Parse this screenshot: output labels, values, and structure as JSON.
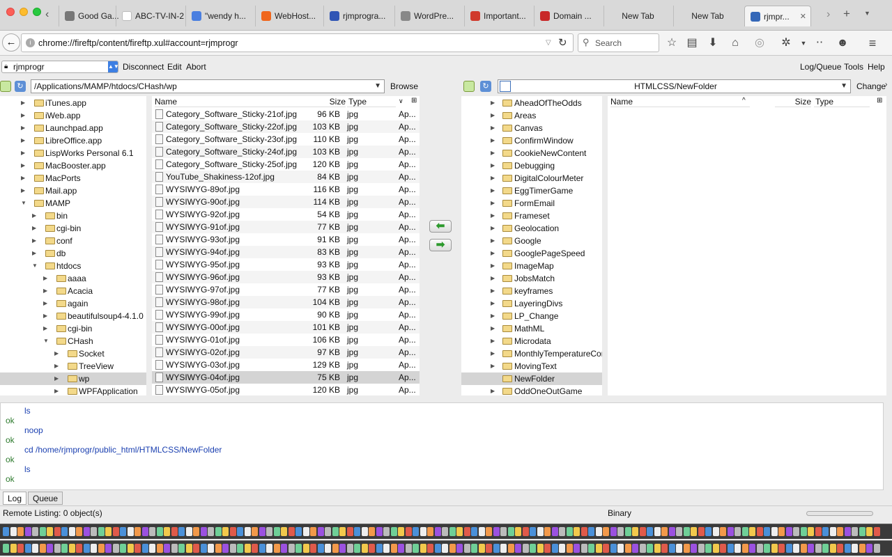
{
  "window": {
    "tabs": [
      {
        "label": "Good Ga...",
        "icon": "page-icon",
        "color": "#777777"
      },
      {
        "label": "ABC-TV-IN-2...",
        "icon": "blank-icon",
        "color": "#ffffff"
      },
      {
        "label": "\"wendy h...",
        "icon": "google-icon",
        "color": "#4a7fe0"
      },
      {
        "label": "WebHost...",
        "icon": "cpanel-icon",
        "color": "#f0661c"
      },
      {
        "label": "rjmprogra...",
        "icon": "amazon-icon",
        "color": "#2f55b5"
      },
      {
        "label": "WordPre...",
        "icon": "wordpress-icon",
        "color": "#888888"
      },
      {
        "label": "Important...",
        "icon": "gmail-icon",
        "color": "#d03a2c"
      },
      {
        "label": "Domain ...",
        "icon": "zoho-icon",
        "color": "#c82828"
      },
      {
        "label": "New Tab",
        "icon": "",
        "color": ""
      },
      {
        "label": "New Tab",
        "icon": "",
        "color": ""
      },
      {
        "label": "rjmpr...",
        "icon": "fireftp-icon",
        "color": "#3568b8"
      }
    ]
  },
  "nav": {
    "url": "chrome://fireftp/content/fireftp.xul#account=rjmprogr",
    "search_placeholder": "Search"
  },
  "ftp": {
    "account": "rjmprogr",
    "menu": {
      "disconnect": "Disconnect",
      "edit": "Edit",
      "abort": "Abort",
      "logqueue": "Log/Queue",
      "tools": "Tools",
      "help": "Help"
    },
    "local_path": "/Applications/MAMP/htdocs/CHash/wp",
    "browse": "Browse",
    "remote_path": "HTMLCSS/NewFolder",
    "change": "Change",
    "local_tree": [
      {
        "name": "iTunes.app",
        "level": 1,
        "state": "closed"
      },
      {
        "name": "iWeb.app",
        "level": 1,
        "state": "closed"
      },
      {
        "name": "Launchpad.app",
        "level": 1,
        "state": "closed"
      },
      {
        "name": "LibreOffice.app",
        "level": 1,
        "state": "closed"
      },
      {
        "name": "LispWorks Personal 6.1",
        "level": 1,
        "state": "closed"
      },
      {
        "name": "MacBooster.app",
        "level": 1,
        "state": "closed"
      },
      {
        "name": "MacPorts",
        "level": 1,
        "state": "closed"
      },
      {
        "name": "Mail.app",
        "level": 1,
        "state": "closed"
      },
      {
        "name": "MAMP",
        "level": 1,
        "state": "open"
      },
      {
        "name": "bin",
        "level": 2,
        "state": "closed"
      },
      {
        "name": "cgi-bin",
        "level": 2,
        "state": "closed"
      },
      {
        "name": "conf",
        "level": 2,
        "state": "closed"
      },
      {
        "name": "db",
        "level": 2,
        "state": "closed"
      },
      {
        "name": "htdocs",
        "level": 2,
        "state": "open"
      },
      {
        "name": "aaaa",
        "level": 3,
        "state": "closed"
      },
      {
        "name": "Acacia",
        "level": 3,
        "state": "closed"
      },
      {
        "name": "again",
        "level": 3,
        "state": "closed"
      },
      {
        "name": "beautifulsoup4-4.1.0",
        "level": 3,
        "state": "closed"
      },
      {
        "name": "cgi-bin",
        "level": 3,
        "state": "closed"
      },
      {
        "name": "CHash",
        "level": 3,
        "state": "open"
      },
      {
        "name": "Socket",
        "level": 4,
        "state": "closed"
      },
      {
        "name": "TreeView",
        "level": 4,
        "state": "closed"
      },
      {
        "name": "wp",
        "level": 4,
        "state": "closed",
        "selected": true
      },
      {
        "name": "WPFApplication",
        "level": 4,
        "state": "closed"
      }
    ],
    "file_headers": {
      "name": "Name",
      "size": "Size",
      "type": "Type"
    },
    "local_files": [
      {
        "name": "Category_Software_Sticky-21of.jpg",
        "size": "96 KB",
        "type": "jpg",
        "date": "Ap..."
      },
      {
        "name": "Category_Software_Sticky-22of.jpg",
        "size": "103 KB",
        "type": "jpg",
        "date": "Ap..."
      },
      {
        "name": "Category_Software_Sticky-23of.jpg",
        "size": "110 KB",
        "type": "jpg",
        "date": "Ap..."
      },
      {
        "name": "Category_Software_Sticky-24of.jpg",
        "size": "103 KB",
        "type": "jpg",
        "date": "Ap..."
      },
      {
        "name": "Category_Software_Sticky-25of.jpg",
        "size": "120 KB",
        "type": "jpg",
        "date": "Ap..."
      },
      {
        "name": "YouTube_Shakiness-12of.jpg",
        "size": "84 KB",
        "type": "jpg",
        "date": "Ap..."
      },
      {
        "name": "WYSIWYG-89of.jpg",
        "size": "116 KB",
        "type": "jpg",
        "date": "Ap..."
      },
      {
        "name": "WYSIWYG-90of.jpg",
        "size": "114 KB",
        "type": "jpg",
        "date": "Ap..."
      },
      {
        "name": "WYSIWYG-92of.jpg",
        "size": "54 KB",
        "type": "jpg",
        "date": "Ap..."
      },
      {
        "name": "WYSIWYG-91of.jpg",
        "size": "77 KB",
        "type": "jpg",
        "date": "Ap..."
      },
      {
        "name": "WYSIWYG-93of.jpg",
        "size": "91 KB",
        "type": "jpg",
        "date": "Ap..."
      },
      {
        "name": "WYSIWYG-94of.jpg",
        "size": "83 KB",
        "type": "jpg",
        "date": "Ap..."
      },
      {
        "name": "WYSIWYG-95of.jpg",
        "size": "93 KB",
        "type": "jpg",
        "date": "Ap..."
      },
      {
        "name": "WYSIWYG-96of.jpg",
        "size": "93 KB",
        "type": "jpg",
        "date": "Ap..."
      },
      {
        "name": "WYSIWYG-97of.jpg",
        "size": "77 KB",
        "type": "jpg",
        "date": "Ap..."
      },
      {
        "name": "WYSIWYG-98of.jpg",
        "size": "104 KB",
        "type": "jpg",
        "date": "Ap..."
      },
      {
        "name": "WYSIWYG-99of.jpg",
        "size": "90 KB",
        "type": "jpg",
        "date": "Ap..."
      },
      {
        "name": "WYSIWYG-00of.jpg",
        "size": "101 KB",
        "type": "jpg",
        "date": "Ap..."
      },
      {
        "name": "WYSIWYG-01of.jpg",
        "size": "106 KB",
        "type": "jpg",
        "date": "Ap..."
      },
      {
        "name": "WYSIWYG-02of.jpg",
        "size": "97 KB",
        "type": "jpg",
        "date": "Ap..."
      },
      {
        "name": "WYSIWYG-03of.jpg",
        "size": "129 KB",
        "type": "jpg",
        "date": "Ap..."
      },
      {
        "name": "WYSIWYG-04of.jpg",
        "size": "75 KB",
        "type": "jpg",
        "date": "Ap...",
        "selected": true
      },
      {
        "name": "WYSIWYG-05of.jpg",
        "size": "120 KB",
        "type": "jpg",
        "date": "Ap..."
      }
    ],
    "remote_tree": [
      {
        "name": "AheadOfTheOdds",
        "state": "closed"
      },
      {
        "name": "Areas",
        "state": "closed"
      },
      {
        "name": "Canvas",
        "state": "closed"
      },
      {
        "name": "ConfirmWindow",
        "state": "closed"
      },
      {
        "name": "CookieNewContent",
        "state": "closed"
      },
      {
        "name": "Debugging",
        "state": "closed"
      },
      {
        "name": "DigitalColourMeter",
        "state": "closed"
      },
      {
        "name": "EggTimerGame",
        "state": "closed"
      },
      {
        "name": "FormEmail",
        "state": "closed"
      },
      {
        "name": "Frameset",
        "state": "closed"
      },
      {
        "name": "Geolocation",
        "state": "closed"
      },
      {
        "name": "Google",
        "state": "closed"
      },
      {
        "name": "GooglePageSpeed",
        "state": "closed"
      },
      {
        "name": "ImageMap",
        "state": "closed"
      },
      {
        "name": "JobsMatch",
        "state": "closed"
      },
      {
        "name": "keyframes",
        "state": "closed"
      },
      {
        "name": "LayeringDivs",
        "state": "closed"
      },
      {
        "name": "LP_Change",
        "state": "closed"
      },
      {
        "name": "MathML",
        "state": "closed"
      },
      {
        "name": "Microdata",
        "state": "closed"
      },
      {
        "name": "MonthlyTemperatureCom",
        "state": "closed"
      },
      {
        "name": "MovingText",
        "state": "closed"
      },
      {
        "name": "NewFolder",
        "state": "none",
        "selected": true
      },
      {
        "name": "OddOneOutGame",
        "state": "closed"
      }
    ],
    "log": [
      {
        "text": "ls",
        "kind": "cmd"
      },
      {
        "text": "ok",
        "kind": "ok"
      },
      {
        "text": "noop",
        "kind": "cmd"
      },
      {
        "text": "ok",
        "kind": "ok"
      },
      {
        "text": "cd /home/rjmprogr/public_html/HTMLCSS/NewFolder",
        "kind": "cmd"
      },
      {
        "text": "ok",
        "kind": "ok"
      },
      {
        "text": "ls",
        "kind": "cmd"
      },
      {
        "text": "ok",
        "kind": "ok"
      }
    ],
    "log_tabs": {
      "log": "Log",
      "queue": "Queue"
    },
    "status_text": "Remote Listing: 0 object(s)",
    "mode": "Binary"
  },
  "colors": {
    "accent": "#3d7fe3",
    "ok": "#2d7a2d",
    "cmd": "#1a3fb0",
    "folder": "#f3d98a"
  }
}
